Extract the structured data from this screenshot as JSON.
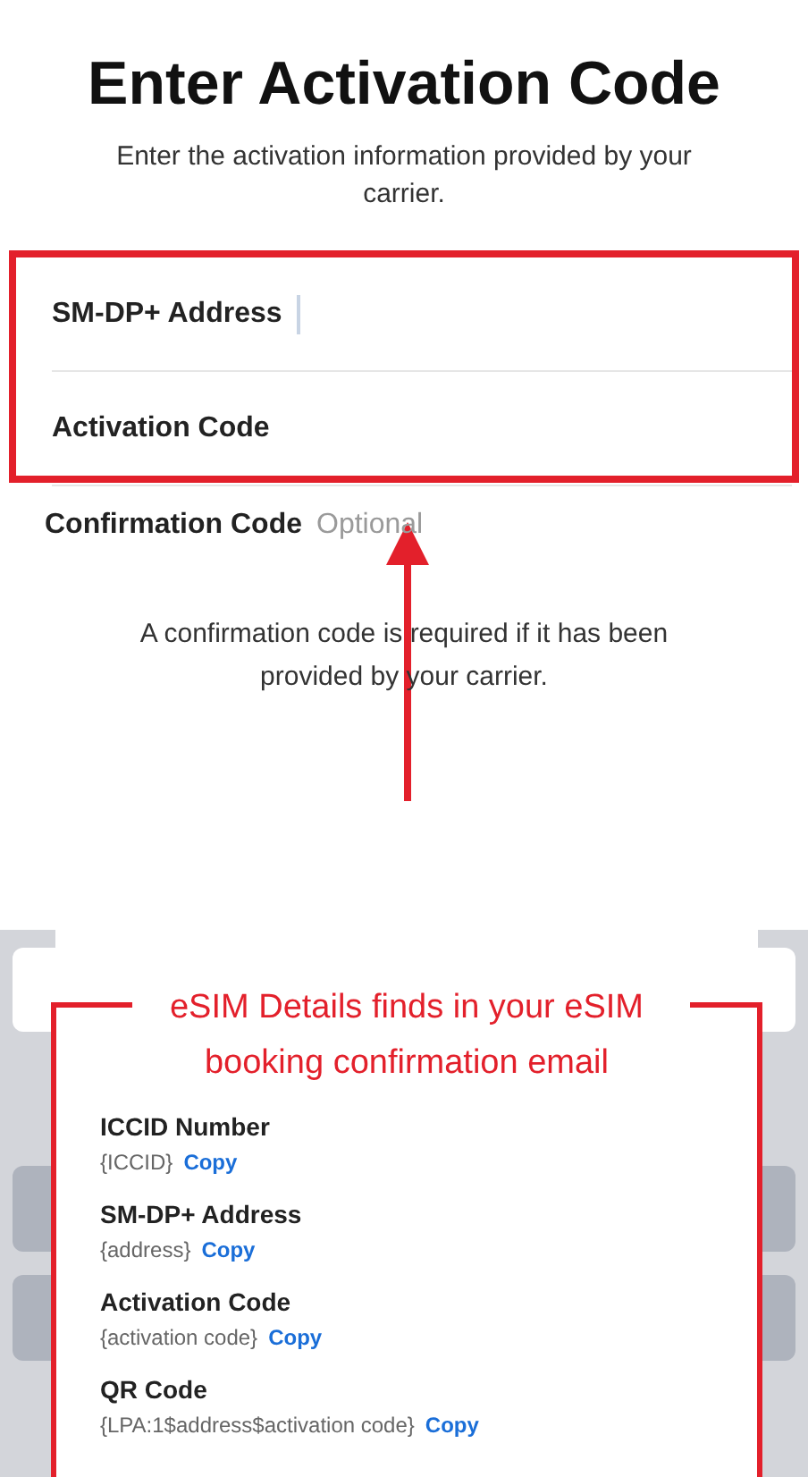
{
  "screen": {
    "title": "Enter Activation Code",
    "subtitle": "Enter the activation information provided by your carrier.",
    "fields": [
      {
        "label": "SM-DP+ Address",
        "highlighted": true,
        "focused": true
      },
      {
        "label": "Activation Code",
        "highlighted": true,
        "focused": false
      },
      {
        "label": "Confirmation Code",
        "placeholder": "Optional",
        "highlighted": false,
        "focused": false
      }
    ],
    "note": "A confirmation code is required if it has been provided by your carrier."
  },
  "annotation": {
    "caption": "eSIM Details finds in your eSIM booking confirmation email",
    "items": [
      {
        "label": "ICCID Number",
        "value": "{ICCID}",
        "action": "Copy"
      },
      {
        "label": "SM-DP+ Address",
        "value": "{address}",
        "action": "Copy"
      },
      {
        "label": "Activation Code",
        "value": "{activation code}",
        "action": "Copy"
      },
      {
        "label": "QR Code",
        "value": "{LPA:1$address$activation code}",
        "action": "Copy"
      }
    ]
  }
}
